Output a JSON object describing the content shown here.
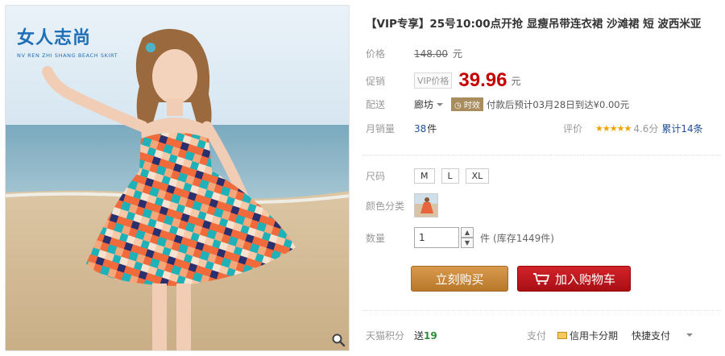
{
  "gallery": {
    "brand_cn": "女人志尚",
    "brand_en": "NV REN ZHI SHANG BEACH SKIRT"
  },
  "product": {
    "title": "【VIP专享】25号10:00点开抢 显瘦吊带连衣裙 沙滩裙 短 波西米亚",
    "price_label": "价格",
    "original_price": "148.00",
    "currency_unit": "元",
    "promo_label": "促销",
    "vip_tag": "VIP价格",
    "promo_price": "39.96",
    "shipping_label": "配送",
    "shipping_city": "廊坊",
    "shipping_badge": "时效",
    "shipping_text": "付款后预计03月28日到达¥0.00元",
    "sales_label": "月销量",
    "sales_count": "38",
    "sales_unit": "件",
    "review_label": "评价",
    "stars": "★★★★★",
    "rating": "4.6分",
    "reviews": "累计14条",
    "size_label": "尺码",
    "sizes": [
      "M",
      "L",
      "XL"
    ],
    "color_label": "颜色分类",
    "qty_label": "数量",
    "qty_value": "1",
    "qty_unit": "件",
    "stock": "(库存1449件)",
    "buy_label": "立刻购买",
    "cart_label": "加入购物车",
    "points_label": "天猫积分",
    "points_prefix": "送",
    "points_value": "19",
    "pay_label": "支付",
    "pay_option": "信用卡分期",
    "quick_pay": "快捷支付"
  },
  "colors": {
    "price_red": "#c40000",
    "link_blue": "#1f4f99",
    "brand_blue": "#1f6fb8",
    "buy_gold": "#c8873a",
    "cart_red": "#c01a20",
    "points_green": "#2e8b3a"
  }
}
